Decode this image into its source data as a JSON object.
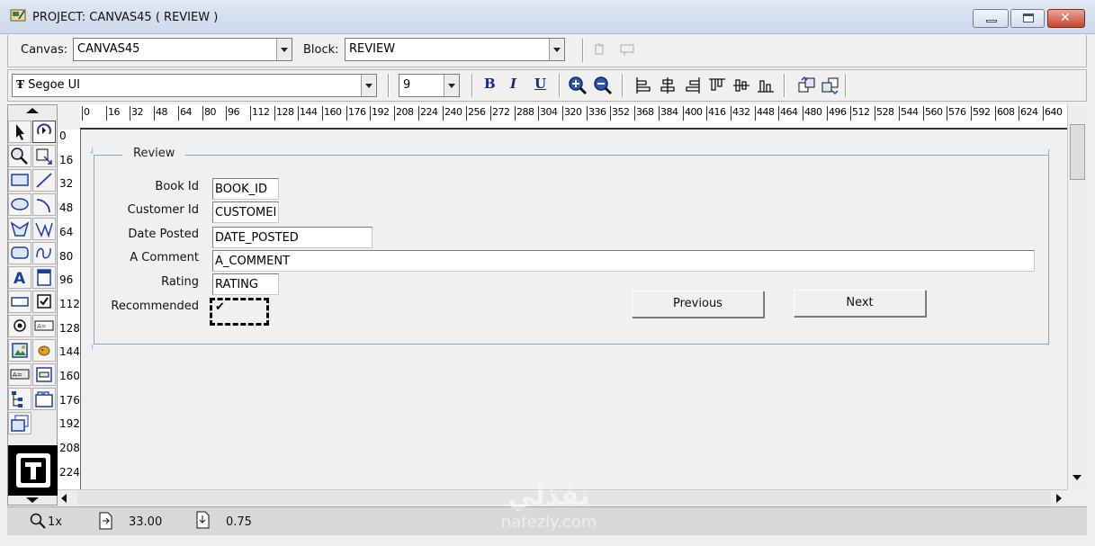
{
  "window": {
    "title": "PROJECT: CANVAS45 ( REVIEW )"
  },
  "toolbar1": {
    "canvas_label": "Canvas:",
    "canvas_value": "CANVAS45",
    "block_label": "Block:",
    "block_value": "REVIEW"
  },
  "toolbar2": {
    "font_value": "Segoe UI",
    "size_value": "9",
    "bold": "B",
    "italic": "I",
    "underline": "U"
  },
  "ruler": {
    "horizontal": [
      "0",
      "16",
      "32",
      "48",
      "64",
      "80",
      "96",
      "112",
      "128",
      "144",
      "160",
      "176",
      "192",
      "208",
      "224",
      "240",
      "256",
      "272",
      "288",
      "304",
      "320",
      "336",
      "352",
      "368",
      "384",
      "400",
      "416",
      "432",
      "448",
      "464",
      "480",
      "496",
      "512",
      "528",
      "544",
      "560",
      "576",
      "592",
      "608",
      "624",
      "640"
    ],
    "vertical": [
      "0",
      "16",
      "32",
      "48",
      "64",
      "80",
      "96",
      "112",
      "128",
      "144",
      "160",
      "176",
      "192",
      "208",
      "224"
    ]
  },
  "form": {
    "frame_title": "Review",
    "fields": [
      {
        "label": "Book Id",
        "value": "BOOK_ID"
      },
      {
        "label": "Customer Id",
        "value": "CUSTOMEI"
      },
      {
        "label": "Date Posted",
        "value": "DATE_POSTED"
      },
      {
        "label": "A Comment",
        "value": "A_COMMENT"
      },
      {
        "label": "Rating",
        "value": "RATING"
      }
    ],
    "checkbox_label": "Recommended",
    "checkbox_mark": "✔",
    "previous_label": "Previous",
    "next_label": "Next"
  },
  "status": {
    "zoom": "1x",
    "x_value": "33.00",
    "y_value": "0.75"
  },
  "watermark": {
    "line1": "نفذلي",
    "line2": "nafezly.com"
  },
  "colors": {
    "accent": "#142b8a",
    "handle": "#5aa0e0"
  }
}
